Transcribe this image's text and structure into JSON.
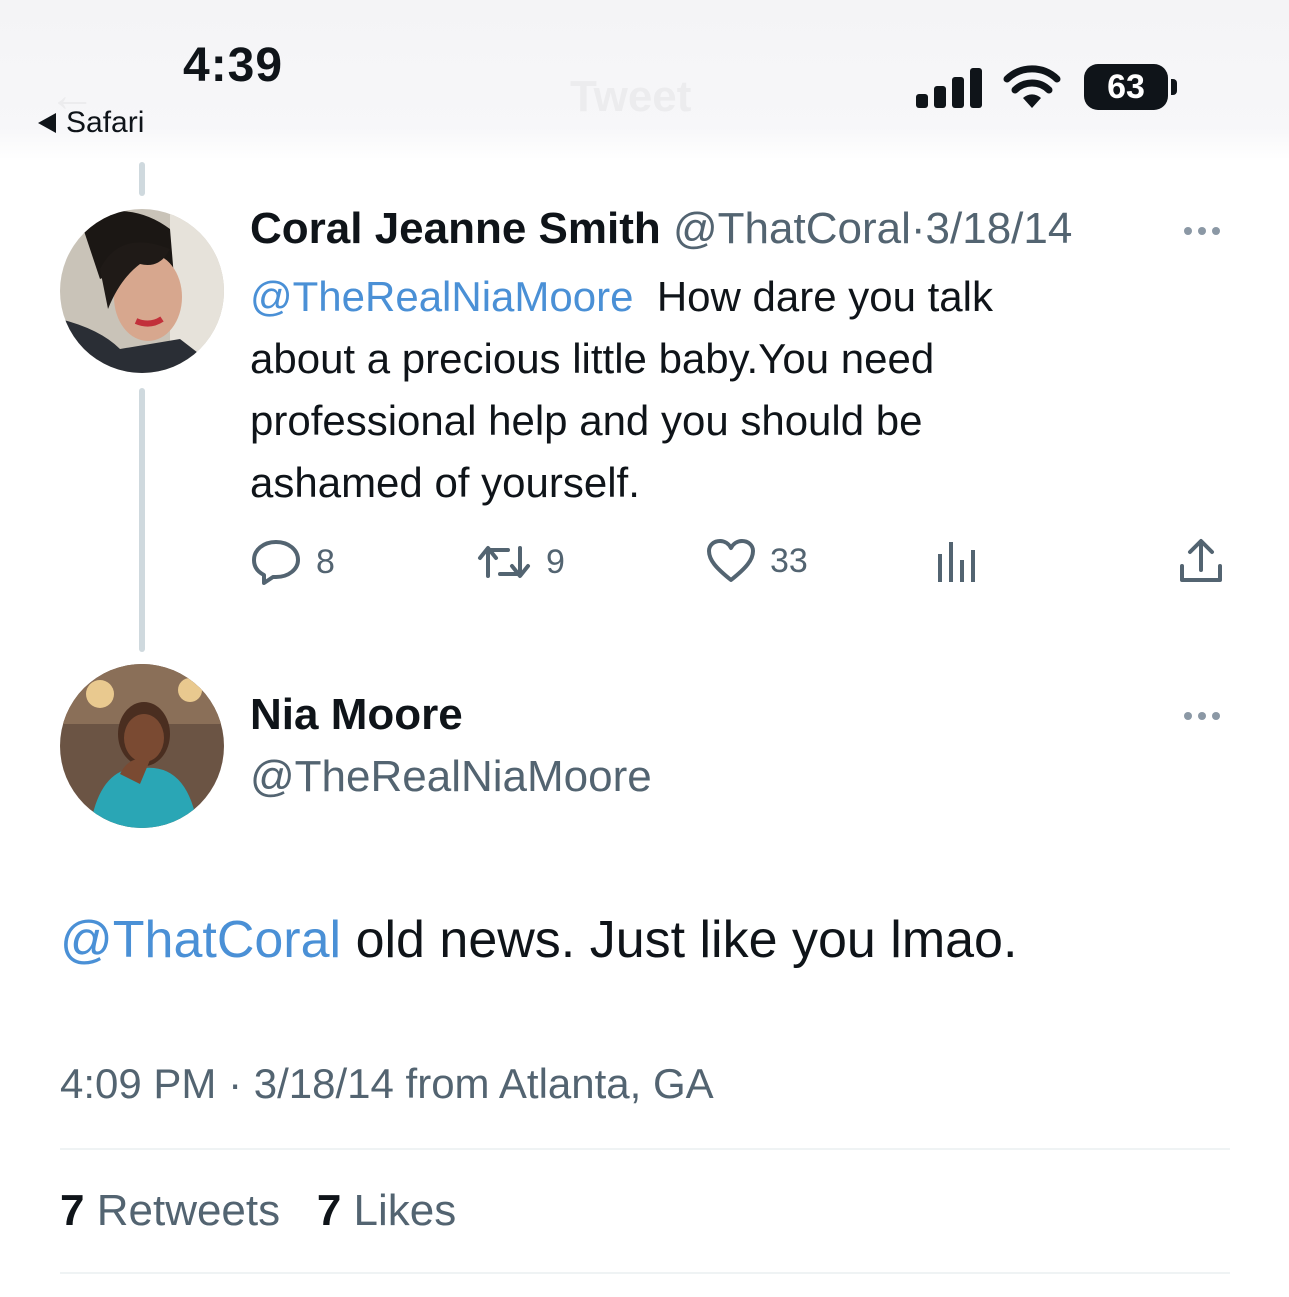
{
  "status_bar": {
    "time": "4:39",
    "back_label": "Safari",
    "battery": "63",
    "faded_title": "Tweet"
  },
  "parent_tweet": {
    "name": "Coral Jeanne Smith",
    "handle": "@ThatCoral",
    "separator": "·",
    "date": "3/18/14",
    "mention": "@TheRealNiaMoore",
    "text_lines": [
      "How dare you talk",
      "about a precious little baby.You need",
      "professional help and you should be",
      "ashamed of yourself."
    ],
    "actions": {
      "replies": "8",
      "retweets": "9",
      "likes": "33"
    }
  },
  "main_tweet": {
    "name": "Nia Moore",
    "handle": "@TheRealNiaMoore",
    "mention": "@ThatCoral",
    "text": "old news. Just like you lmao.",
    "timestamp": "4:09 PM · 3/18/14 from Atlanta, GA",
    "retweet_count": "7",
    "retweet_label": "Retweets",
    "like_count": "7",
    "like_label": "Likes"
  },
  "colors": {
    "link": "#4a90d6",
    "secondary_text": "#536471",
    "thread_line": "#cfd9de"
  }
}
